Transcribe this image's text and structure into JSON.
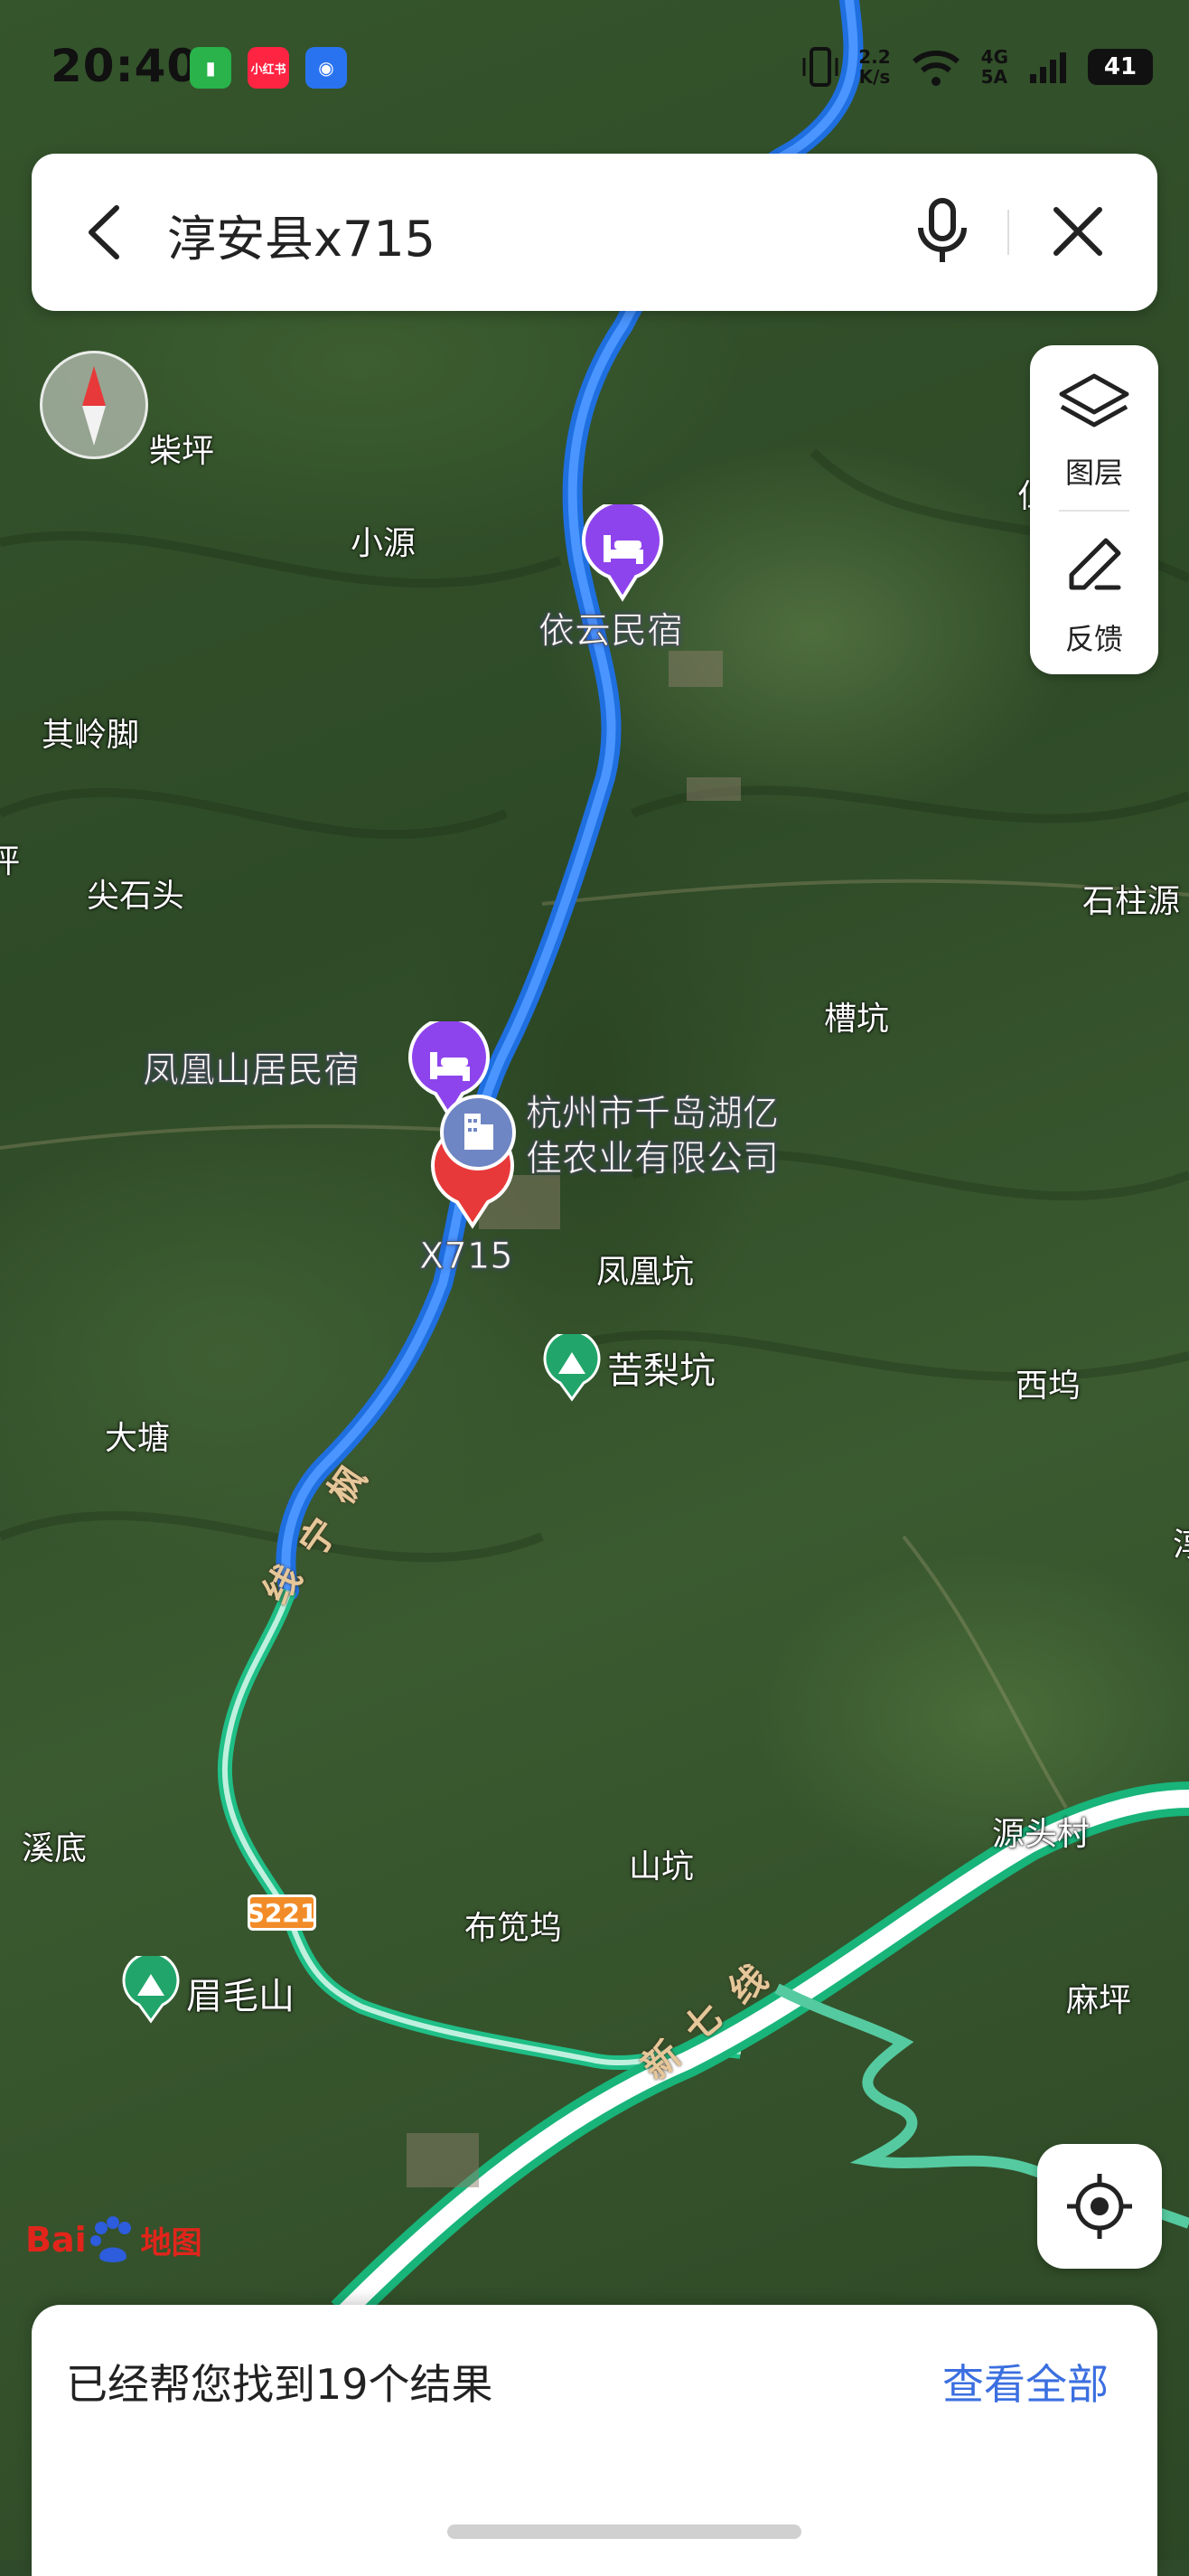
{
  "status_bar": {
    "time": "20:40",
    "apps": [
      {
        "name": "green-app",
        "glyph": "▮",
        "color": "#29b34a"
      },
      {
        "name": "xiaohongshu-app",
        "glyph": "小红书",
        "color": "#ff2442"
      },
      {
        "name": "blue-app",
        "glyph": "◉",
        "color": "#2a73f0"
      }
    ],
    "net_speed_value": "2.2",
    "net_speed_unit": "K/s",
    "network_top": "4G",
    "network_bottom": "5A",
    "battery": "41"
  },
  "search": {
    "query": "淳安县x715",
    "icons": {
      "back": "back-arrow-icon",
      "mic": "microphone-icon",
      "close": "close-icon"
    }
  },
  "map_controls": {
    "layers_label": "图层",
    "feedback_label": "反馈"
  },
  "places": [
    {
      "id": "chaiping",
      "label": "柴坪"
    },
    {
      "id": "xiaoyuan",
      "label": "小源"
    },
    {
      "id": "qilingjiao",
      "label": "其岭脚"
    },
    {
      "id": "ping",
      "label": "坪"
    },
    {
      "id": "jianshitou",
      "label": "尖石头"
    },
    {
      "id": "shizhuyuan",
      "label": "石柱源"
    },
    {
      "id": "caokeng",
      "label": "槽坑"
    },
    {
      "id": "fenghuangkeng",
      "label": "凤凰坑"
    },
    {
      "id": "xiwu",
      "label": "西坞"
    },
    {
      "id": "datang",
      "label": "大塘"
    },
    {
      "id": "xidi",
      "label": "溪底"
    },
    {
      "id": "shankeng",
      "label": "山坑"
    },
    {
      "id": "yuantoucun",
      "label": "源头村"
    },
    {
      "id": "budouwu",
      "label": "布笕坞"
    },
    {
      "id": "maping",
      "label": "麻坪"
    },
    {
      "id": "edge-right",
      "label": "淳"
    },
    {
      "id": "edge-top-right",
      "label": "仁"
    }
  ],
  "pois": {
    "yiyun_minsu": "依云民宿",
    "fenghuangshanju_minsu": "凤凰山居民宿",
    "company_line1": "杭州市千岛湖亿",
    "company_line2": "佳农业有限公司",
    "target_label": "X715",
    "kulikeng": "苦梨坑",
    "meimaoshan": "眉毛山"
  },
  "roads": {
    "fengning_line_1": "枫",
    "fengning_line_2": "宁",
    "fengning_line_3": "线",
    "xinqi_line_1": "新",
    "xinqi_line_2": "七",
    "xinqi_line_3": "线",
    "shield": "S221"
  },
  "logo": {
    "bai": "Bai",
    "ditu": "地图"
  },
  "bottom_sheet": {
    "result_text": "已经帮您找到19个结果",
    "view_all": "查看全部"
  }
}
